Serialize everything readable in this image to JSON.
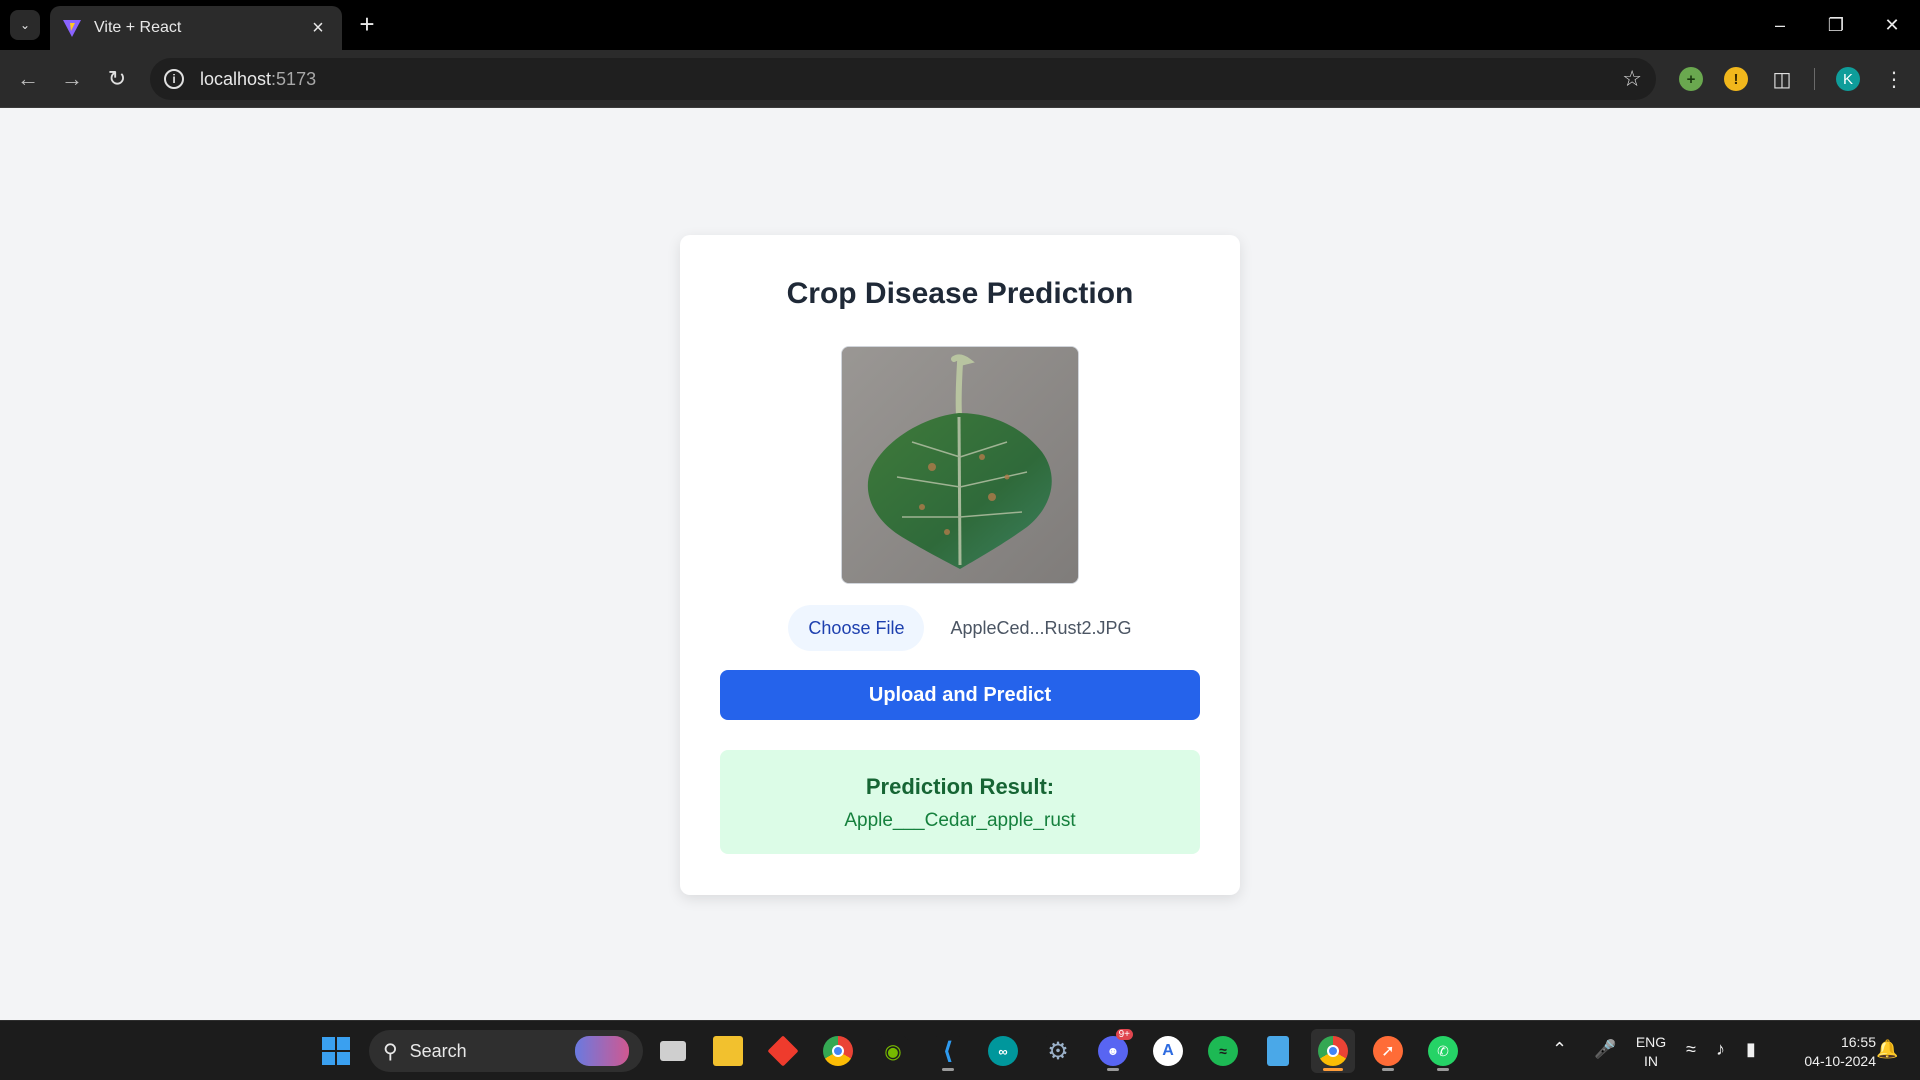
{
  "browser": {
    "tab_title": "Vite + React",
    "url_host": "localhost",
    "url_port": ":5173",
    "profile_initial": "K"
  },
  "page": {
    "title": "Crop Disease Prediction",
    "choose_file_label": "Choose File",
    "file_name": "AppleCed...Rust2.JPG",
    "predict_button": "Upload and Predict",
    "result_title": "Prediction Result:",
    "result_value": "Apple___Cedar_apple_rust"
  },
  "taskbar": {
    "search_label": "Search",
    "apps": [
      "start-icon",
      "search-icon",
      "task-view-icon",
      "file-explorer-icon",
      "anydesk-icon",
      "chrome-icon",
      "nvidia-icon",
      "vscode-icon",
      "arduino-icon",
      "settings-icon",
      "discord-icon",
      "app-store-icon",
      "spotify-icon",
      "notepad-icon",
      "chrome-icon",
      "postman-icon",
      "whatsapp-icon"
    ],
    "discord_badge": "9+",
    "language_line1": "ENG",
    "language_line2": "IN",
    "time": "16:55",
    "date": "04-10-2024"
  },
  "colors": {
    "primary": "#2563eb",
    "result_bg": "#dcfce7",
    "result_text": "#166534"
  }
}
